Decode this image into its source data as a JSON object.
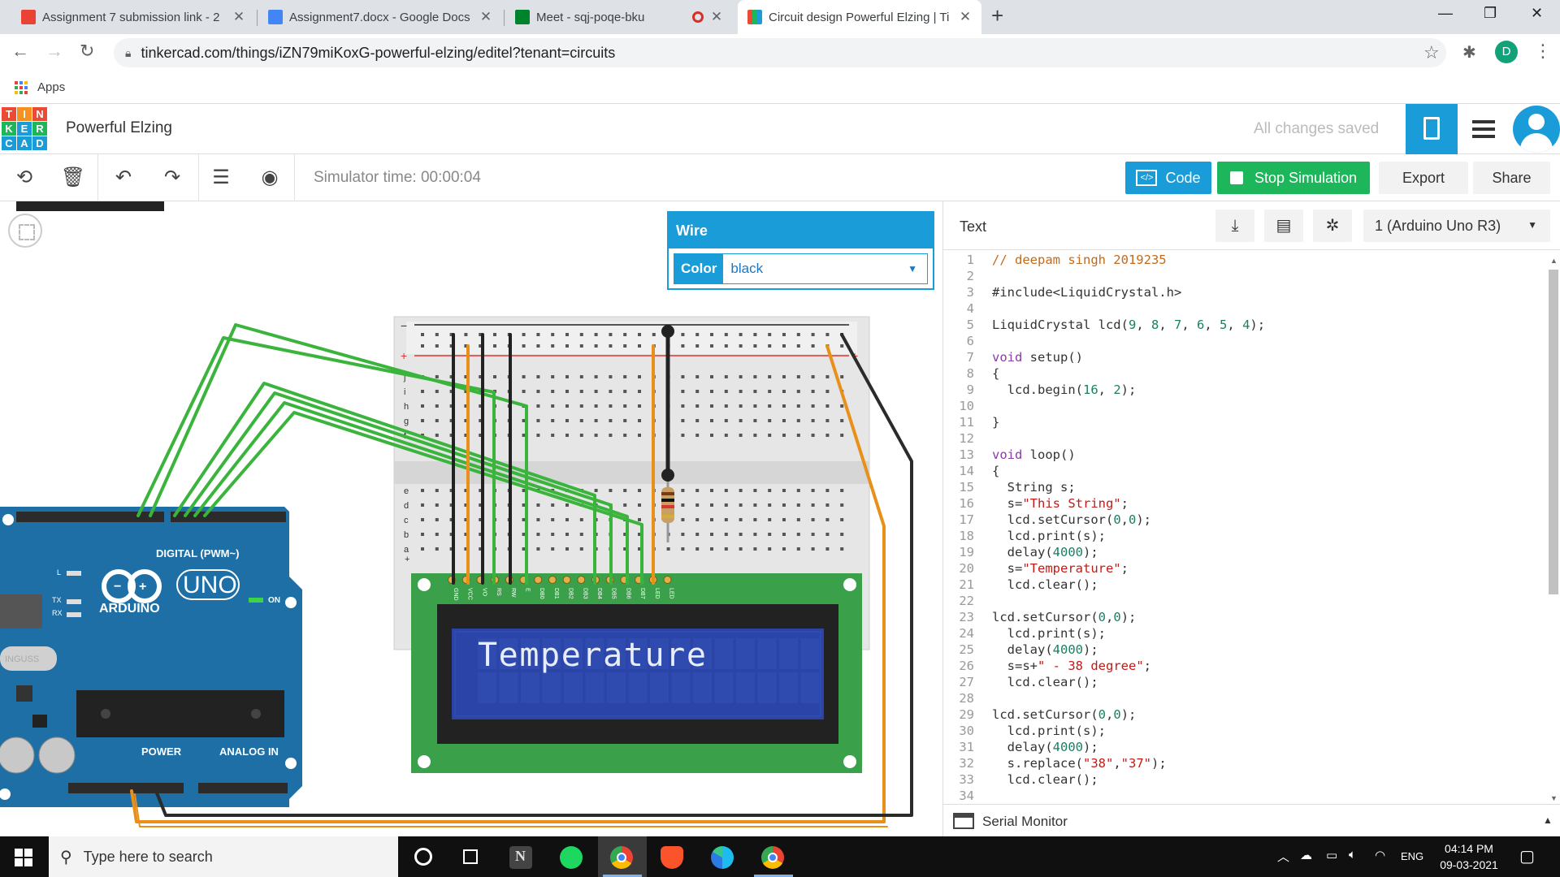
{
  "browser": {
    "tabs": [
      {
        "title": "Assignment 7 submission link - 2",
        "favicon_color": "#ea4335",
        "active": false
      },
      {
        "title": "Assignment7.docx - Google Docs",
        "favicon_color": "#4285f4",
        "active": false
      },
      {
        "title": "Meet - sqj-poqe-bku",
        "favicon_color": "#00832d",
        "active": false,
        "recording": true
      },
      {
        "title": "Circuit design Powerful Elzing | Ti",
        "favicon_color": "#e94b35",
        "active": true
      }
    ],
    "url": "tinkercad.com/things/iZN79miKoxG-powerful-elzing/editel?tenant=circuits",
    "profile_initial": "D",
    "bookmarks": {
      "apps_label": "Apps"
    }
  },
  "header": {
    "logo_letters": [
      "T",
      "I",
      "N",
      "K",
      "E",
      "R",
      "C",
      "A",
      "D"
    ],
    "logo_colors": [
      "#e94b35",
      "#f6901e",
      "#e94b35",
      "#1eb65b",
      "#1a9cd8",
      "#1eb65b",
      "#1a9cd8",
      "#1a9cd8",
      "#1a9cd8"
    ],
    "design_name": "Powerful Elzing",
    "save_status": "All changes saved"
  },
  "toolbar": {
    "simulator_time": "Simulator time: 00:00:04",
    "code_label": "Code",
    "stop_label": "Stop Simulation",
    "export_label": "Export",
    "share_label": "Share"
  },
  "inspector": {
    "title": "Wire",
    "color_label": "Color",
    "color_value": "black"
  },
  "circuit": {
    "lcd_text": "Temperature",
    "arduino_labels": {
      "brand": "ARDUINO",
      "model": "UNO",
      "digital": "DIGITAL (PWM~)",
      "power": "POWER",
      "analog": "ANALOG IN",
      "on": "ON",
      "tx": "TX",
      "rx": "RX",
      "l": "L"
    },
    "lcd_pins": [
      "GND",
      "VCC",
      "VO",
      "RS",
      "RW",
      "E",
      "DB0",
      "DB1",
      "DB2",
      "DB3",
      "DB4",
      "DB5",
      "DB6",
      "DB7",
      "LED",
      "LED"
    ],
    "breadboard_rows_top": [
      "j",
      "i",
      "h",
      "g",
      "f"
    ],
    "breadboard_rows_bottom": [
      "e",
      "d",
      "c",
      "b",
      "a"
    ]
  },
  "code_panel": {
    "mode_label": "Text",
    "board_select": "1 (Arduino Uno R3)",
    "lines": [
      "// deepam singh 2019235",
      "",
      "#include<LiquidCrystal.h>",
      "",
      "LiquidCrystal lcd(9, 8, 7, 6, 5, 4);",
      "",
      "void setup()",
      "{",
      "  lcd.begin(16, 2);",
      "",
      "}",
      "",
      "void loop()",
      "{",
      "  String s;",
      "  s=\"This String\";",
      "  lcd.setCursor(0,0);",
      "  lcd.print(s);",
      "  delay(4000);",
      "  s=\"Temperature\";",
      "  lcd.clear();",
      "",
      "lcd.setCursor(0,0);",
      "  lcd.print(s);",
      "  delay(4000);",
      "  s=s+\" - 38 degree\";",
      "  lcd.clear();",
      "",
      "lcd.setCursor(0,0);",
      "  lcd.print(s);",
      "  delay(4000);",
      "  s.replace(\"38\",\"37\");",
      "  lcd.clear();",
      ""
    ],
    "serial_monitor_label": "Serial Monitor"
  },
  "taskbar": {
    "search_placeholder": "Type here to search",
    "language": "ENG",
    "time": "04:14 PM",
    "date": "09-03-2021"
  }
}
